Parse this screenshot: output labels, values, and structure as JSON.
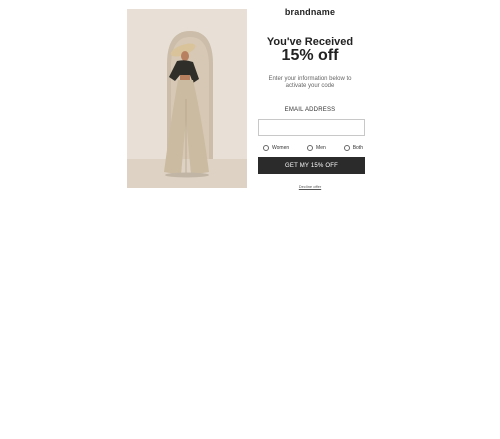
{
  "popup": {
    "brand": "brandname",
    "headline": "You've Received",
    "offer": "15% off",
    "subtext_line1": "Enter your information below to",
    "subtext_line2": "activate your code",
    "email_label": "EMAIL ADDRESS",
    "email_value": "",
    "gender_options": [
      "Women",
      "Men",
      "Both"
    ],
    "cta_label": "GET MY 15% OFF",
    "decline_label": "Decline offer"
  },
  "colors": {
    "cta_background": "#2b2b2b",
    "cta_text": "#ffffff",
    "hero_wall": "#e5ddd3",
    "hero_arch_shadow": "#c4b6a5"
  },
  "icons": {
    "hero": "fashion-model-photo"
  }
}
